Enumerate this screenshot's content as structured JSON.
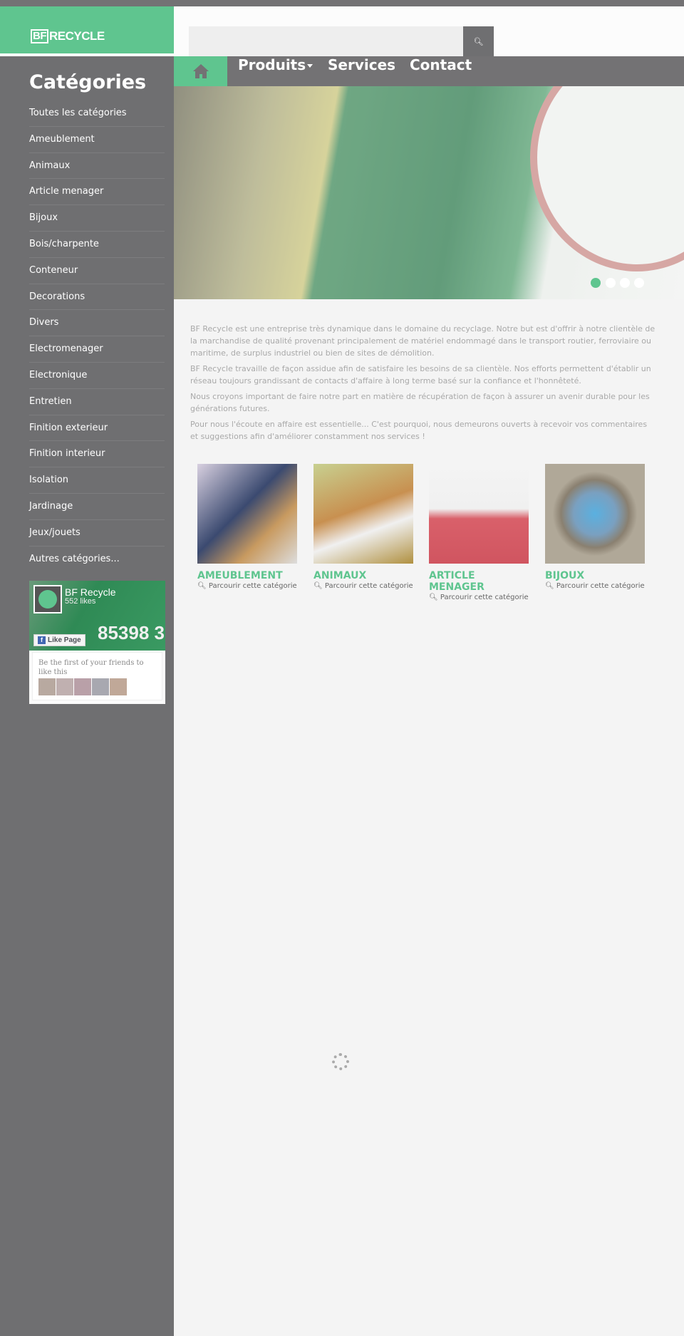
{
  "brand": {
    "logo_text_bf": "BF",
    "logo_text_rest": "RECYCLE",
    "accent": "#5fc58f",
    "gray": "#737274"
  },
  "search": {
    "placeholder": "",
    "icon": "search-icon"
  },
  "nav": {
    "home_icon": "home-icon",
    "items": [
      {
        "label": "Produits"
      },
      {
        "label": "Services"
      },
      {
        "label": "Contact"
      }
    ]
  },
  "slider": {
    "slides": 4,
    "active": 1
  },
  "intro": {
    "paragraphs": [
      "BF Recycle est une entreprise très dynamique dans le domaine du recyclage. Notre but est d'offrir à notre clientèle de la marchandise de qualité provenant principalement de matériel endommagé dans le transport routier, ferroviaire ou maritime, de surplus industriel ou bien de sites de démolition.",
      "BF Recycle travaille de façon assidue afin de satisfaire les besoins de sa clientèle. Nos efforts permettent d'établir un réseau toujours grandissant de contacts d'affaire à long terme basé sur la confiance et l'honnêteté.",
      "Nous croyons important de faire notre part en matière de récupération de façon à assurer un avenir durable pour les générations futures.",
      "Pour nous l'écoute en affaire est essentielle... C'est pourquoi, nous demeurons ouverts à recevoir vos commentaires et suggestions afin d'améliorer constamment nos services !"
    ]
  },
  "cards": [
    {
      "title": "AMEUBLEMENT",
      "link": "Parcourir cette catégorie"
    },
    {
      "title": "ANIMAUX",
      "link": "Parcourir cette catégorie"
    },
    {
      "title": "ARTICLE MENAGER",
      "link": "Parcourir cette catégorie"
    },
    {
      "title": "BIJOUX",
      "link": "Parcourir cette catégorie"
    }
  ],
  "sidebar": {
    "title": "Catégories",
    "items": [
      "Toutes les catégories",
      "Ameublement",
      "Animaux",
      "Article menager",
      "Bijoux",
      "Bois/charpente",
      "Conteneur",
      "Decorations",
      "Divers",
      "Electromenager",
      "Electronique",
      "Entretien",
      "Finition exterieur",
      "Finition interieur",
      "Isolation",
      "Jardinage",
      "Jeux/jouets",
      "Autres catégories..."
    ]
  },
  "facebook": {
    "page_name": "BF Recycle",
    "likes": "552 likes",
    "like_button": "Like Page",
    "friends_text": "Be the first of your friends to like this",
    "cover_number": "85398 3"
  }
}
